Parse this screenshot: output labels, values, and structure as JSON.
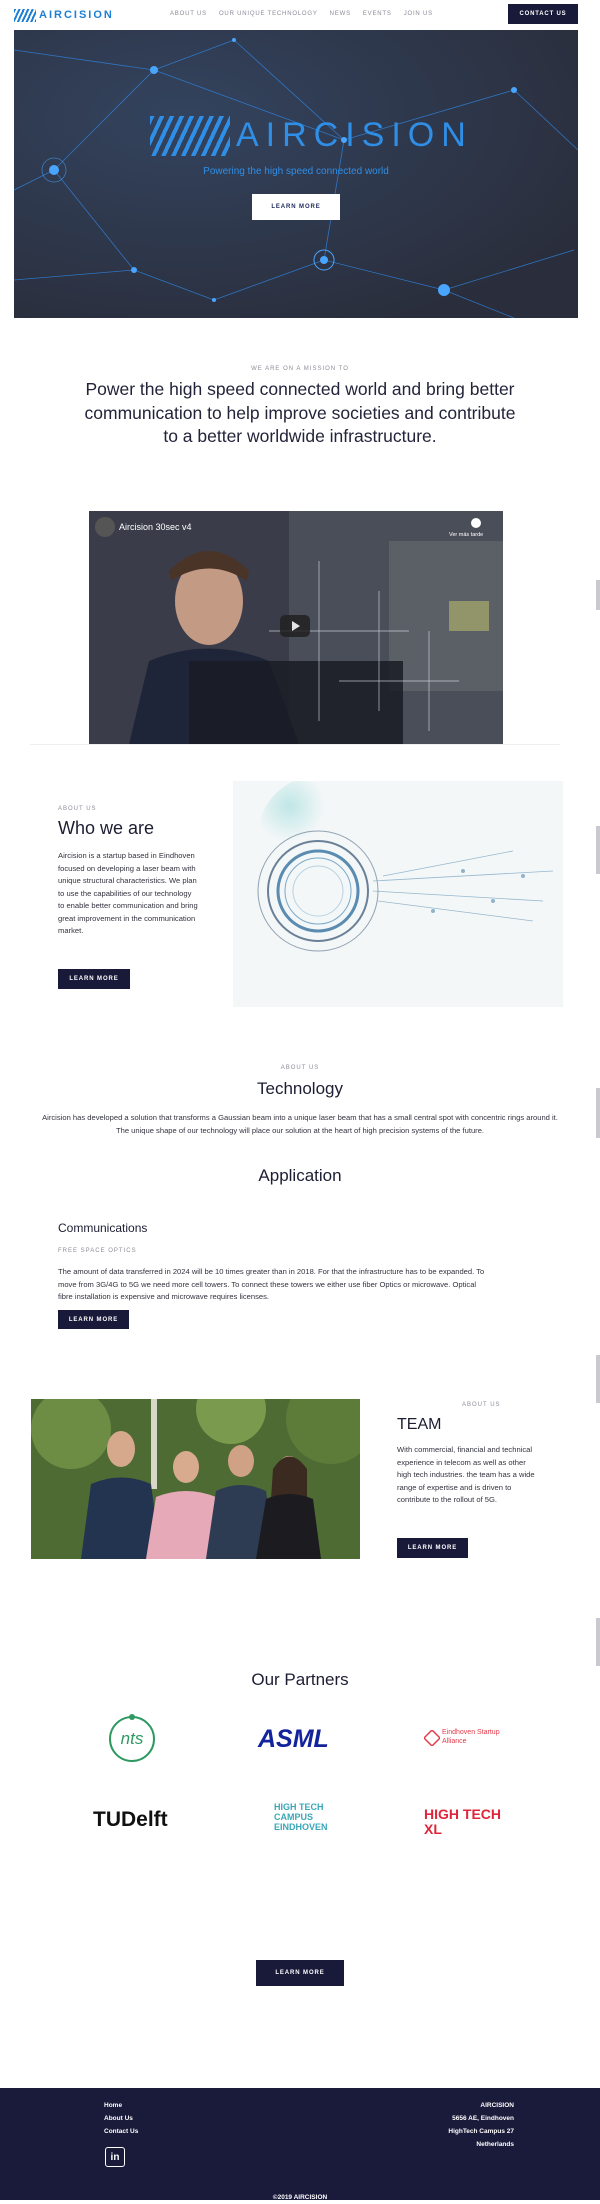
{
  "nav": {
    "logo_text": "AIRCISION",
    "links": [
      "ABOUT US",
      "OUR UNIQUE TECHNOLOGY",
      "NEWS",
      "EVENTS",
      "JOIN US"
    ],
    "contact_label": "CONTACT US"
  },
  "hero": {
    "title": "AIRCISION",
    "subtitle": "Powering the high speed connected world",
    "button_label": "LEARN MORE"
  },
  "mission": {
    "eyebrow": "WE ARE ON A MISSION TO",
    "statement": "Power the high speed connected world and bring better communication to help improve societies and contribute to a better worldwide infrastructure."
  },
  "video": {
    "title": "Aircision 30sec v4",
    "watch_later": "Ver más tarde"
  },
  "about": {
    "eyebrow": "ABOUT US",
    "title": "Who we are",
    "body": "Aircision is a startup based in Eindhoven focused on developing a laser beam with unique structural characteristics. We plan to use the capabilities of our technology to enable better communication and bring great improvement in the communication market.",
    "button_label": "LEARN MORE"
  },
  "technology": {
    "eyebrow": "ABOUT US",
    "title": "Technology",
    "body": "Aircision has developed a solution that transforms a Gaussian beam into a unique laser beam that has a small central spot with concentric rings around it. The unique shape of our technology will place our solution at the heart of high precision systems of the future."
  },
  "application": {
    "title": "Application",
    "subtitle": "Communications",
    "eyebrow": "FREE SPACE OPTICS",
    "body": "The amount of data transferred in 2024 will be 10 times greater than in 2018. For that the infrastructure has to be expanded. To move from 3G/4G to 5G we need more cell towers. To connect these towers we either use fiber Optics or microwave. Optical fibre installation is expensive and microwave requires licenses.",
    "button_label": "LEARN MORE"
  },
  "team": {
    "eyebrow": "ABOUT US",
    "title": "TEAM",
    "body": "With commercial, financial and technical experience in telecom as well as other high tech industries. the team has a wide range of expertise and is driven to contribute to the rollout of 5G.",
    "button_label": "LEARN MORE"
  },
  "partners": {
    "title": "Our Partners",
    "logos": [
      {
        "name": "nts-logo",
        "text": "nts"
      },
      {
        "name": "asml-logo",
        "text": "ASML"
      },
      {
        "name": "eindhoven-startup-alliance-logo",
        "text": "Eindhoven Startup Alliance"
      },
      {
        "name": "tu-delft-logo",
        "text": "TUDelft"
      },
      {
        "name": "high-tech-campus-logo",
        "text": "HIGH TECH CAMPUS EINDHOVEN"
      },
      {
        "name": "high-tech-xl-logo",
        "text": "HIGH TECH XL"
      }
    ]
  },
  "cta": {
    "button_label": "LEARN MORE"
  },
  "footer": {
    "links": [
      "Home",
      "About Us",
      "Contact Us"
    ],
    "company": "AIRCISION",
    "address": [
      "5656 AE, Eindhoven",
      "HighTech Campus 27",
      "Netherlands"
    ],
    "copyright": "©2019 AIRCISION"
  },
  "colors": {
    "brand_blue": "#2f8ee6",
    "navy": "#191a3a",
    "footer_bg": "#1a1a3a"
  }
}
